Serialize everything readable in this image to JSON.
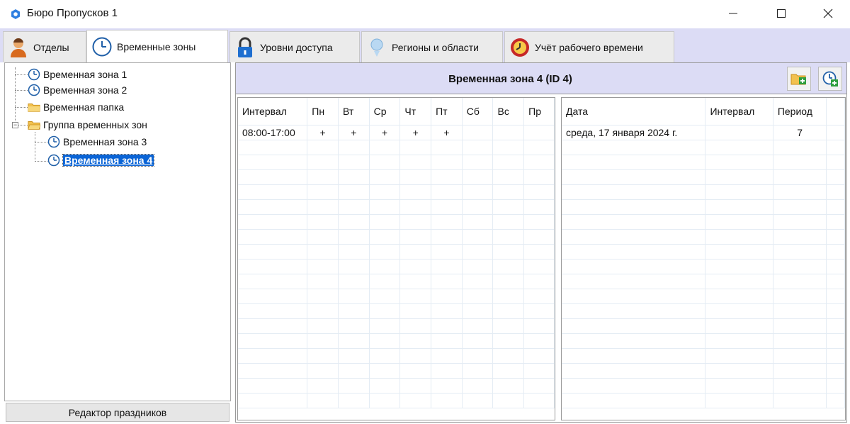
{
  "window": {
    "title": "Бюро Пропусков 1"
  },
  "tabs": [
    {
      "label": "Отделы",
      "icon": "person-icon"
    },
    {
      "label": "Временные зоны",
      "icon": "clock-icon"
    },
    {
      "label": "Уровни доступа",
      "icon": "lock-icon"
    },
    {
      "label": "Регионы и области",
      "icon": "region-icon"
    },
    {
      "label": "Учёт рабочего времени",
      "icon": "worktime-icon"
    }
  ],
  "tree": {
    "items": [
      {
        "label": "Временная зона 1"
      },
      {
        "label": "Временная зона 2"
      },
      {
        "label": "Временная папка"
      },
      {
        "label": "Группа временных зон"
      },
      {
        "label": "Временная зона 3"
      },
      {
        "label": "Временная зона 4"
      }
    ]
  },
  "holiday_editor": {
    "label": "Редактор праздников"
  },
  "zone": {
    "title": "Временная зона 4 (ID 4)"
  },
  "intervals_table": {
    "columns": [
      "Интервал",
      "Пн",
      "Вт",
      "Ср",
      "Чт",
      "Пт",
      "Сб",
      "Вс",
      "Пр"
    ],
    "rows": [
      [
        "08:00-17:00",
        "+",
        "+",
        "+",
        "+",
        "+",
        "",
        "",
        ""
      ]
    ]
  },
  "dates_table": {
    "columns": [
      "Дата",
      "Интервал",
      "Период"
    ],
    "rows": [
      [
        "среда, 17 января 2024 г.",
        "",
        "7"
      ]
    ]
  }
}
